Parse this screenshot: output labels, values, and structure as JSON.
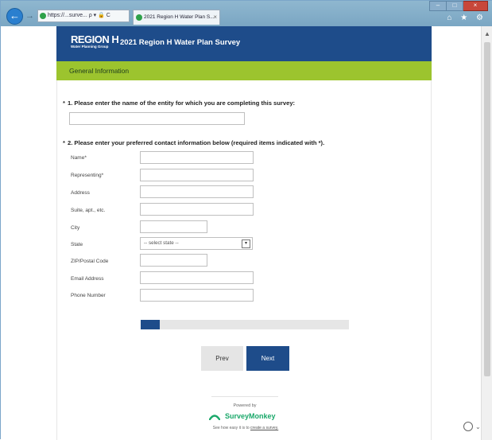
{
  "browser": {
    "address_text": "https://...surve... ρ ▾ 🔒 C",
    "tab_title": "2021 Region H Water Plan S...",
    "tab_close": "×",
    "back_glyph": "←",
    "forward_glyph": "→",
    "window_min": "–",
    "window_max": "□",
    "window_close": "×",
    "toolbar_icons": "⌂ ★ ⚙"
  },
  "header": {
    "logo_main": "REGION H",
    "logo_sub": "Water Planning Group",
    "title": "2021 Region H Water Plan Survey",
    "brand_color": "#1e4c8a"
  },
  "section": {
    "title": "General Information",
    "color": "#9cc42e"
  },
  "questions": {
    "q1": {
      "star": "*",
      "text": "1. Please enter the name of the entity for which you are completing this survey:"
    },
    "q2": {
      "star": "*",
      "text": "2. Please enter your preferred contact information below (required items indicated with *)."
    }
  },
  "fields": {
    "name": "Name*",
    "representing": "Representing*",
    "address": "Address",
    "suite": "Suite, apt., etc.",
    "city": "City",
    "state": "State",
    "state_placeholder": "-- select state --",
    "zip": "ZIP/Postal Code",
    "email": "Email Address",
    "phone": "Phone Number"
  },
  "progress": {
    "fraction": 0.09
  },
  "buttons": {
    "prev": "Prev",
    "next": "Next"
  },
  "footer": {
    "powered_by": "Powered by",
    "brand": "SurveyMonkey",
    "see_how": "See how easy it is to ",
    "create_link": "create a survey."
  }
}
